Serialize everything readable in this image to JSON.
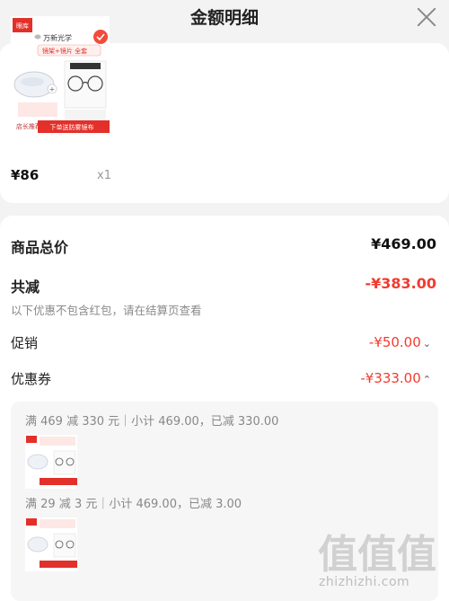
{
  "header": {
    "title": "金额明细"
  },
  "product": {
    "image_texts": {
      "brand_mark": "眼库",
      "partner_name": "万新光学",
      "banner": "镜架+镜片 全套",
      "stamp": "店长推荐",
      "strip": "下单送防雾镜布"
    },
    "price": "¥86",
    "qty": "x1"
  },
  "summary": {
    "total_label": "商品总价",
    "total_value": "¥469.00",
    "discount_label": "共减",
    "discount_value": "-¥383.00",
    "note": "以下优惠不包含红包，请在结算页查看",
    "promo_label": "促销",
    "promo_value": "-¥50.00",
    "coupon_label": "优惠券",
    "coupon_value": "-¥333.00"
  },
  "coupons": [
    {
      "text": "满 469 减 330 元｜小计 469.00，已减 330.00"
    },
    {
      "text": "满 29 减 3 元｜小计 469.00，已减 3.00"
    }
  ],
  "watermark": {
    "glyphs": "值值值",
    "url": "zhizhizhi.com"
  },
  "colors": {
    "accent_red": "#f23b2f",
    "background": "#f3f3f3"
  }
}
